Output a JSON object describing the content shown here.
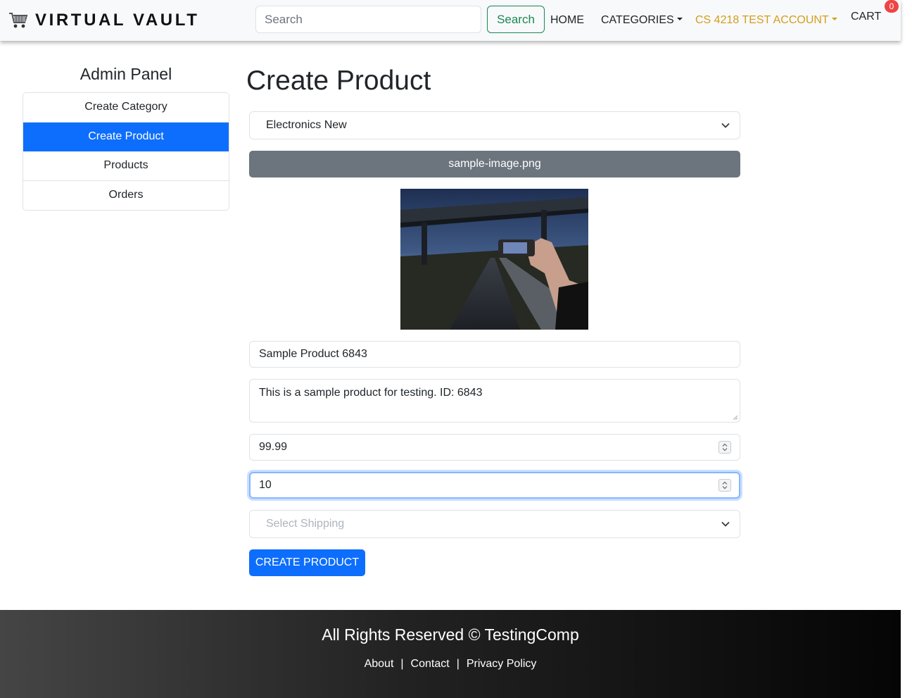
{
  "navbar": {
    "brand": "VIRTUAL VAULT",
    "search": {
      "placeholder": "Search",
      "button": "Search"
    },
    "links": {
      "home": "HOME",
      "categories": "CATEGORIES",
      "account": "CS 4218 TEST ACCOUNT",
      "cart": "CART"
    },
    "cart_count": "0",
    "colors": {
      "account": "#d39e1f",
      "search_button": "#198754",
      "badge": "#ef4444"
    }
  },
  "sidebar": {
    "title": "Admin Panel",
    "items": [
      {
        "label": "Create Category",
        "active": false
      },
      {
        "label": "Create Product",
        "active": true
      },
      {
        "label": "Products",
        "active": false
      },
      {
        "label": "Orders",
        "active": false
      }
    ]
  },
  "main": {
    "title": "Create Product",
    "category_value": "Electronics New",
    "upload_label": "sample-image.png",
    "preview_icon": "photo-preview",
    "name_value": "Sample Product 6843",
    "description_value": "This is a sample product for testing. ID: 6843",
    "price_value": "99.99",
    "quantity_value": "10",
    "shipping_placeholder": "Select Shipping",
    "submit_label": "CREATE PRODUCT",
    "colors": {
      "primary": "#0d6efd",
      "upload": "#6c757d"
    }
  },
  "footer": {
    "copyright": "All Rights Reserved © TestingComp",
    "links": [
      "About",
      "Contact",
      "Privacy Policy"
    ],
    "separator": "|"
  }
}
